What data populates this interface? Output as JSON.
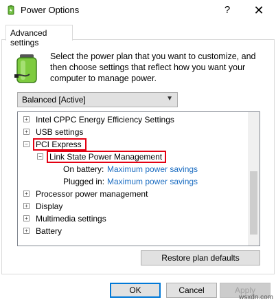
{
  "window": {
    "title": "Power Options",
    "help_glyph": "?",
    "close_glyph": "✕"
  },
  "tabs": [
    {
      "label": "Advanced settings"
    }
  ],
  "description": "Select the power plan that you want to customize, and then choose settings that reflect how you want your computer to manage power.",
  "plan_select": {
    "value": "Balanced [Active]"
  },
  "tree": {
    "rows": [
      {
        "label": "Intel CPPC Energy Efficiency Settings",
        "expander": "+"
      },
      {
        "label": "USB settings",
        "expander": "+"
      },
      {
        "label": "PCI Express",
        "expander": "−"
      },
      {
        "label": "Link State Power Management",
        "expander": "−"
      },
      {
        "label": "On battery:",
        "value": "Maximum power savings"
      },
      {
        "label": "Plugged in:",
        "value": "Maximum power savings"
      },
      {
        "label": "Processor power management",
        "expander": "+"
      },
      {
        "label": "Display",
        "expander": "+"
      },
      {
        "label": "Multimedia settings",
        "expander": "+"
      },
      {
        "label": "Battery",
        "expander": "+"
      }
    ]
  },
  "buttons": {
    "restore": "Restore plan defaults",
    "ok": "OK",
    "cancel": "Cancel",
    "apply": "Apply"
  },
  "watermark": "wsxdn.com",
  "colors": {
    "link_value": "#1a6cc1",
    "highlight": "#e30012",
    "focus": "#0078d7"
  },
  "icons": {
    "app": "power-options-icon",
    "battery": "battery-plug-icon"
  }
}
